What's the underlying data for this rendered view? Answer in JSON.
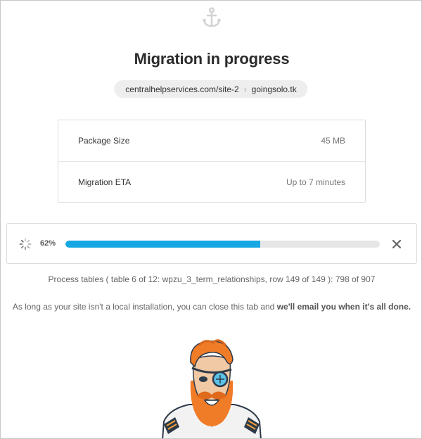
{
  "header": {
    "icon": "anchor-icon",
    "title": "Migration in progress"
  },
  "route": {
    "source": "centralhelpservices.com/site-2",
    "separator_icon": "chevron-right-icon",
    "destination": "goingsolo.tk"
  },
  "info": {
    "rows": [
      {
        "label": "Package Size",
        "value": "45 MB"
      },
      {
        "label": "Migration ETA",
        "value": "Up to 7 minutes"
      }
    ]
  },
  "progress": {
    "percent_label": "62%",
    "fraction": 0.62,
    "bar_color": "#17a8e3",
    "spinner_icon": "spinner-icon",
    "close_icon": "close-icon"
  },
  "status_text": "Process tables ( table 6 of 12: wpzu_3_term_relationships, row 149 of 149 ): 798 of 907",
  "note": {
    "text": "As long as your site isn't a local installation, you can close this tab and ",
    "emphasis": "we'll email you when it's all done."
  }
}
